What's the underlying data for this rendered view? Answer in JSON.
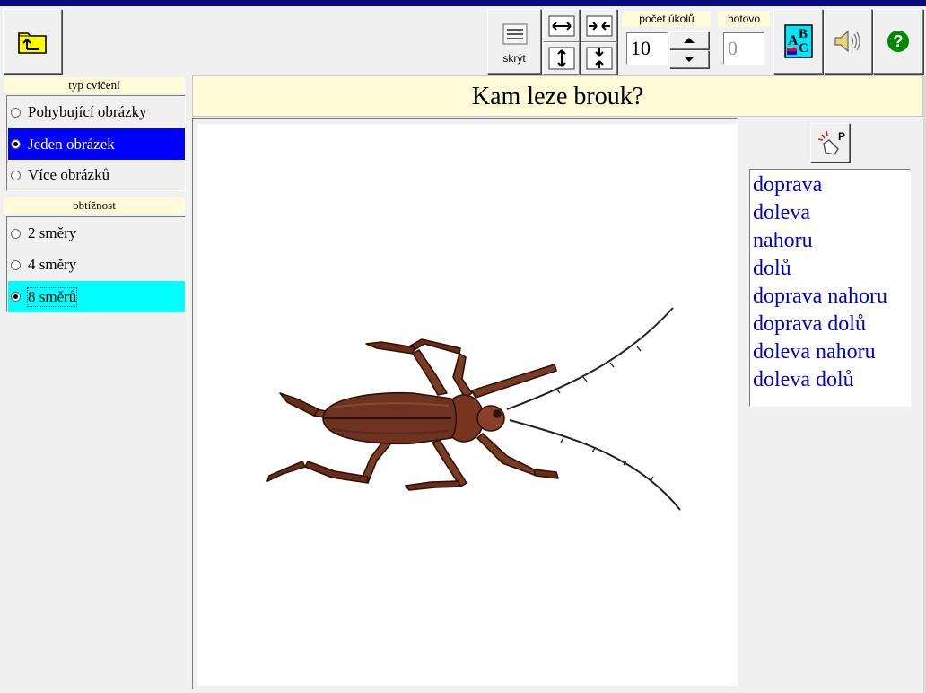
{
  "toolbar": {
    "back_icon": "folder-up-icon",
    "hide_label": "skrýt",
    "task_count_label": "počet úkolů",
    "task_count_value": "10",
    "done_label": "hotovo",
    "done_value": "0",
    "abc_icon": "abc-icon",
    "sound_icon": "speaker-icon",
    "help_icon": "help-icon"
  },
  "sidebar": {
    "exercise_type_title": "typ cvičení",
    "exercise_types": [
      {
        "label": "Pohybující obrázky",
        "selected": false
      },
      {
        "label": "Jeden obrázek",
        "selected": true
      },
      {
        "label": "Více obrázků",
        "selected": false
      }
    ],
    "difficulty_title": "obtížnost",
    "difficulties": [
      {
        "label": "2 směry",
        "selected": false
      },
      {
        "label": "4 směry",
        "selected": false
      },
      {
        "label": "8 směrů",
        "selected": true
      }
    ]
  },
  "main": {
    "question": "Kam leze brouk?",
    "picture": "beetle-crawling-right-up"
  },
  "answers_panel": {
    "pointer_label": "P",
    "options": [
      "doprava",
      "doleva",
      "nahoru",
      "dolů",
      "doprava nahoru",
      "doprava dolů",
      "doleva nahoru",
      "doleva dolů"
    ]
  },
  "colors": {
    "title_blue": "#0000cc",
    "selected_blue": "#0000ff",
    "selected_cyan": "#00ffff",
    "caption_yellow": "#fffbd9"
  }
}
